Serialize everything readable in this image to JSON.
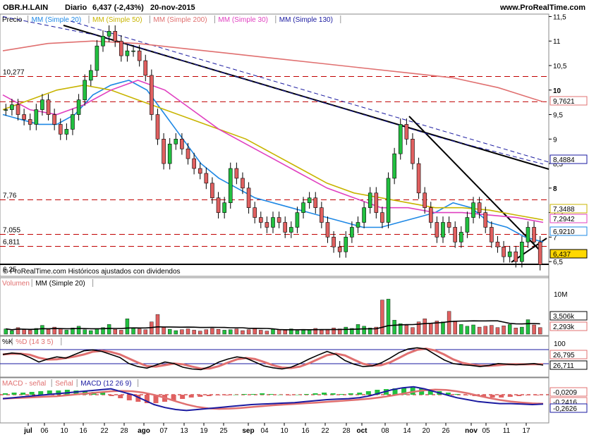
{
  "header": {
    "symbol": "OBR.H.LAIN",
    "period": "Diario",
    "last_change": "6,437 (-2,43%)",
    "date": "20-nov-2015",
    "site": "www.ProRealTime.com"
  },
  "price_panel": {
    "legend": [
      {
        "label": "Precio",
        "color": "#000000"
      },
      {
        "label": "MM (Simple 20)",
        "color": "#1e88e5"
      },
      {
        "label": "MM (Simple 50)",
        "color": "#c8b400"
      },
      {
        "label": "MM (Simple 200)",
        "color": "#e07070"
      },
      {
        "label": "MM (Simple 30)",
        "color": "#e040c0"
      },
      {
        "label": "MM (Simple 130)",
        "color": "#1a1aa0"
      }
    ],
    "copyright": "© ProRealTime.com  Históricos ajustados con dividendos",
    "y_ticks": [
      "11,5",
      "11",
      "10,5",
      "10",
      "9,5",
      "9",
      "8,5",
      "8",
      "7,5",
      "7",
      "6,5"
    ],
    "hlines_left": [
      {
        "label": "10,277",
        "value": 10.277
      },
      {
        "label": "7,76",
        "value": 7.76
      },
      {
        "label": "7,055",
        "value": 7.055
      },
      {
        "label": "6,811",
        "value": 6.811
      },
      {
        "label": "6,25",
        "value": 6.25
      }
    ],
    "dashed_levels": [
      10.277,
      9.762,
      7.76,
      7.055,
      6.811
    ],
    "right_labels": [
      {
        "text": "9,7621",
        "value": 9.7621,
        "color": "#e07070"
      },
      {
        "text": "8,4884",
        "value": 8.4884,
        "color": "#1a1aa0"
      },
      {
        "text": "7,3488",
        "value": 7.3488,
        "color": "#c8b400"
      },
      {
        "text": "7,2942",
        "value": 7.2942,
        "color": "#e040c0"
      },
      {
        "text": "6,9210",
        "value": 6.921,
        "color": "#1e88e5"
      },
      {
        "text": "6,437",
        "value": 6.437,
        "color": "#000000"
      }
    ]
  },
  "volume_panel": {
    "legend": [
      {
        "label": "Volumen",
        "color": "#e07070"
      },
      {
        "label": "MM (Simple 20)",
        "color": "#000000"
      }
    ],
    "y_ticks": [
      "10M"
    ],
    "right_labels": [
      {
        "text": "3,506k",
        "color": "#000000"
      },
      {
        "text": "2,293k",
        "color": "#e07070"
      }
    ]
  },
  "stoch_panel": {
    "legend": [
      {
        "label": "%K",
        "color": "#000000"
      },
      {
        "label": "%D (14 3 5)",
        "color": "#e07070"
      }
    ],
    "y_ticks": [
      "100"
    ],
    "right_labels": [
      {
        "text": "26,795",
        "color": "#e07070"
      },
      {
        "text": "26,711",
        "color": "#000000"
      }
    ]
  },
  "macd_panel": {
    "legend": [
      {
        "label": "MACD - señal",
        "color": "#e07070"
      },
      {
        "label": "Señal",
        "color": "#e07070"
      },
      {
        "label": "MACD (12 26 9)",
        "color": "#1a1aa0"
      }
    ],
    "right_labels": [
      {
        "text": "-0,0209",
        "color": "#e07070"
      },
      {
        "text": "-0,2416",
        "color": "#e07070"
      },
      {
        "text": "-0,2626",
        "color": "#1a1aa0"
      }
    ]
  },
  "x_axis": {
    "labels": [
      {
        "text": "jul",
        "bold": true
      },
      {
        "text": "06",
        "bold": false
      },
      {
        "text": "10",
        "bold": false
      },
      {
        "text": "16",
        "bold": false
      },
      {
        "text": "22",
        "bold": false
      },
      {
        "text": "28",
        "bold": false
      },
      {
        "text": "ago",
        "bold": true
      },
      {
        "text": "07",
        "bold": false
      },
      {
        "text": "13",
        "bold": false
      },
      {
        "text": "19",
        "bold": false
      },
      {
        "text": "25",
        "bold": false
      },
      {
        "text": "sep",
        "bold": true
      },
      {
        "text": "04",
        "bold": false
      },
      {
        "text": "10",
        "bold": false
      },
      {
        "text": "16",
        "bold": false
      },
      {
        "text": "22",
        "bold": false
      },
      {
        "text": "28",
        "bold": false
      },
      {
        "text": "oct",
        "bold": true
      },
      {
        "text": "08",
        "bold": false
      },
      {
        "text": "14",
        "bold": false
      },
      {
        "text": "20",
        "bold": false
      },
      {
        "text": "26",
        "bold": false
      },
      {
        "text": "nov",
        "bold": true
      },
      {
        "text": "05",
        "bold": false
      },
      {
        "text": "11",
        "bold": false
      },
      {
        "text": "17",
        "bold": false
      }
    ]
  },
  "chart_data": {
    "type": "line",
    "title": "OBR.H.LAIN Diario",
    "ylim": [
      6.2,
      11.55
    ],
    "close": [
      9.6,
      9.7,
      9.5,
      9.4,
      9.3,
      9.6,
      9.8,
      9.5,
      9.3,
      9.1,
      9.2,
      9.5,
      9.8,
      10.2,
      10.4,
      10.9,
      11.1,
      11.2,
      11.0,
      10.7,
      10.8,
      10.8,
      10.6,
      10.3,
      9.5,
      9.0,
      8.5,
      8.9,
      9.0,
      8.8,
      8.6,
      8.4,
      8.3,
      8.1,
      7.8,
      7.5,
      7.7,
      8.4,
      8.2,
      8.0,
      7.6,
      7.4,
      7.3,
      7.2,
      7.4,
      7.3,
      7.1,
      7.2,
      7.5,
      7.7,
      7.8,
      7.6,
      7.3,
      7.0,
      6.8,
      6.7,
      7.0,
      7.2,
      7.3,
      7.6,
      7.9,
      7.5,
      7.3,
      8.2,
      8.7,
      9.3,
      9.0,
      8.5,
      7.9,
      7.6,
      7.3,
      7.0,
      7.3,
      7.2,
      6.9,
      7.1,
      7.4,
      7.7,
      7.5,
      7.2,
      6.9,
      6.8,
      6.6,
      6.7,
      6.5,
      6.9,
      7.2,
      6.9,
      6.44
    ],
    "series": [
      {
        "name": "MM (Simple 20)",
        "values": [
          9.5,
          9.4,
          9.3,
          9.3,
          9.5,
          9.9,
          10.1,
          10.2,
          10.0,
          9.5,
          9.0,
          8.5,
          8.2,
          8.0,
          7.8,
          7.7,
          7.6,
          7.5,
          7.4,
          7.3,
          7.2,
          7.2,
          7.3,
          7.4,
          7.5,
          7.7,
          7.6,
          7.3,
          7.2,
          7.0,
          6.9
        ]
      },
      {
        "name": "MM (Simple 50)",
        "values": [
          9.6,
          9.8,
          10.0,
          10.1,
          10.0,
          9.8,
          9.6,
          9.4,
          9.2,
          9.0,
          8.7,
          8.4,
          8.1,
          7.9,
          7.8,
          7.7,
          7.6,
          7.6,
          7.55,
          7.45,
          7.35
        ]
      },
      {
        "name": "MM (Simple 200)",
        "values": [
          10.8,
          10.95,
          11.0,
          10.95,
          10.85,
          10.75,
          10.65,
          10.55,
          10.45,
          10.35,
          10.25,
          10.05,
          9.76
        ]
      },
      {
        "name": "MM (Simple 30)",
        "values": [
          9.9,
          9.6,
          9.5,
          9.7,
          10.0,
          10.2,
          10.0,
          9.6,
          9.2,
          8.9,
          8.6,
          8.3,
          8.0,
          7.8,
          7.6,
          7.6,
          7.5,
          7.5,
          7.45,
          7.4,
          7.3
        ]
      },
      {
        "name": "MM (Simple 130)",
        "values": [
          11.5,
          11.3,
          11.1,
          10.8,
          10.5,
          10.2,
          9.9,
          9.6,
          9.3,
          9.0,
          8.75,
          8.49
        ]
      }
    ]
  }
}
